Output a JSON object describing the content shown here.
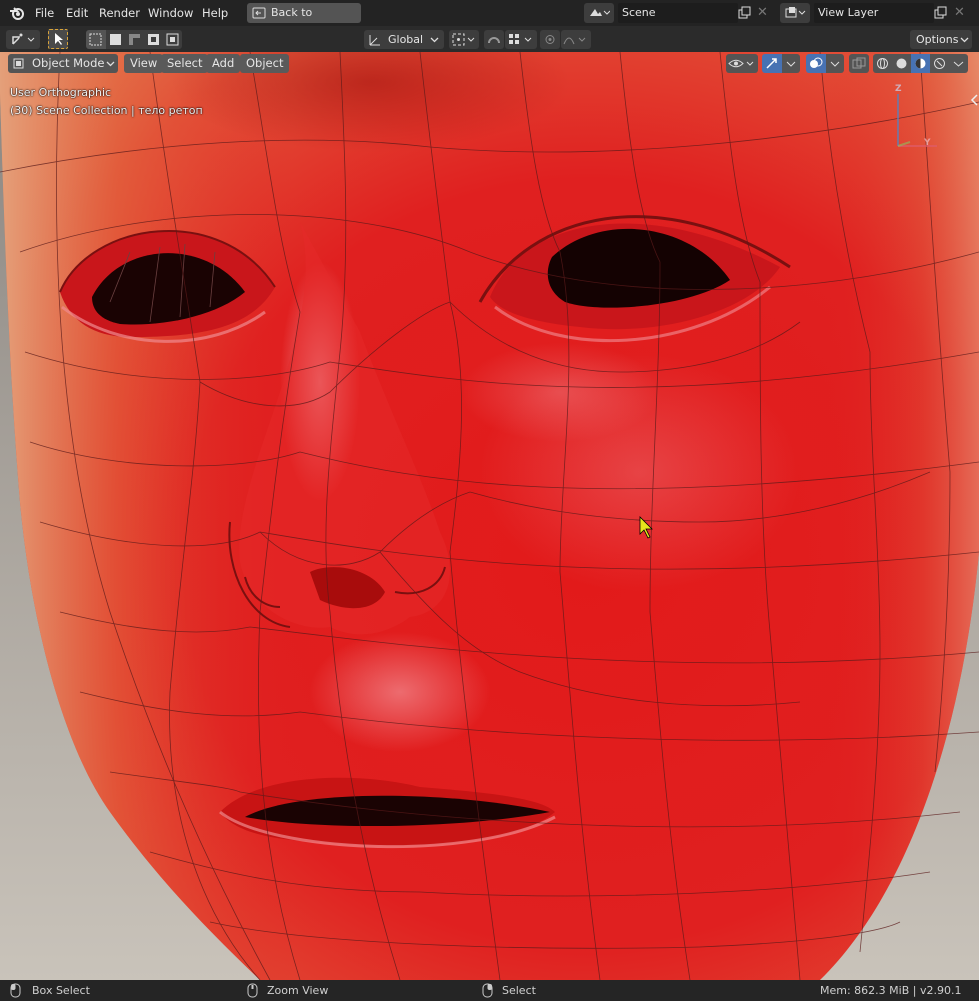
{
  "menu": {
    "items": [
      "File",
      "Edit",
      "Render",
      "Window",
      "Help"
    ],
    "back_button": "Back to Previous",
    "scene_name": "Scene",
    "view_layer": "View Layer"
  },
  "toolbar": {
    "transform_orientation": "Global",
    "options_label": "Options"
  },
  "viewport": {
    "mode_label": "Object Mode",
    "menus": [
      "View",
      "Select",
      "Add",
      "Object"
    ],
    "view_name": "User Orthographic",
    "collection_info": "(30) Scene Collection | тело ретоп",
    "gizmo_axes": {
      "z": "Z",
      "y": "Y"
    }
  },
  "status": {
    "left_action": "Box Select",
    "middle_action": "Zoom View",
    "right_action": "Select",
    "memory_version": "Mem: 862.3 MiB | v2.90.1"
  },
  "colors": {
    "skin": "#e31e1e",
    "background_viewport": "#bdb7ae",
    "accent_blue": "#4772b3",
    "wire": "#5a1a1a"
  }
}
